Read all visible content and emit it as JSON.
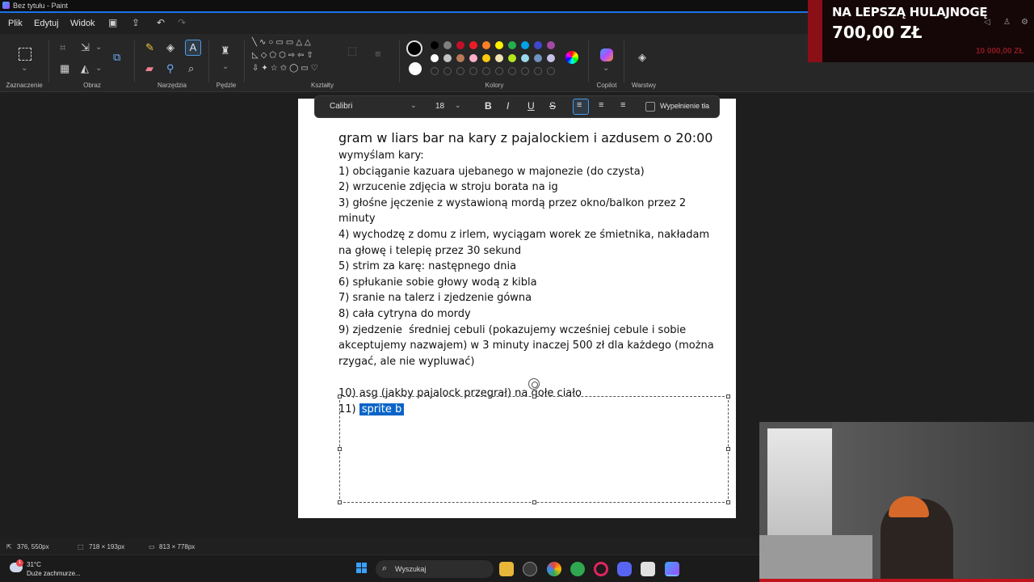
{
  "window": {
    "title": "Bez tytułu - Paint"
  },
  "menu": {
    "file": "Plik",
    "edit": "Edytuj",
    "view": "Widok"
  },
  "ribbon": {
    "groups": {
      "selection": "Zaznaczenie",
      "image": "Obraz",
      "tools": "Narzędzia",
      "brushes": "Pędzle",
      "shapes": "Kształty",
      "colors": "Kolory",
      "copilot": "Copilot",
      "layers": "Warstwy"
    },
    "primary_color": "#000000",
    "secondary_color": "#ffffff",
    "palette_row1": [
      "#000000",
      "#7f7f7f",
      "#c3102a",
      "#ed1c24",
      "#ff7f27",
      "#fff200",
      "#22b14c",
      "#00a2e8",
      "#3f48cc",
      "#a349a4"
    ],
    "palette_row2": [
      "#ffffff",
      "#c3c3c3",
      "#b97a57",
      "#ffaec9",
      "#ffc90e",
      "#efe4b0",
      "#b5e61d",
      "#99d9ea",
      "#7092be",
      "#c8bfe7"
    ]
  },
  "text_toolbar": {
    "font": "Calibri",
    "size": "18",
    "bold": "B",
    "italic": "I",
    "underline": "U",
    "strike": "S",
    "fill_background": "Wypełnienie tła"
  },
  "document": {
    "heading": "gram w liars bar na kary z pajalockiem i azdusem o 20:00",
    "lines": [
      "wymyślam kary:",
      "1) obciąganie kazuara ujebanego w majonezie (do czysta)",
      "2) wrzucenie zdjęcia w stroju borata na ig",
      "3) głośne jęczenie z wystawioną mordą przez okno/balkon przez 2",
      "minuty",
      "4) wychodzę z domu z irlem, wyciągam worek ze śmietnika, nakładam",
      "na głowę i telepię przez 30 sekund",
      "5) strim za karę: następnego dnia",
      "6) spłukanie sobie głowy wodą z kibla",
      "7) sranie na talerz i zjedzenie gówna",
      "8) cała cytryna do mordy",
      "9) zjedzenie  średniej cebuli (pokazujemy wcześniej cebule i sobie",
      "akceptujemy nazwajem) w 3 minuty inaczej 500 zł dla każdego (można",
      "rzygać, ale nie wypluwać)",
      "",
      "10) asg (jakby pajalock przegrał) na gołe ciało"
    ],
    "last_prefix": "11) ",
    "last_selected": "sprite b"
  },
  "status": {
    "cursor": "376, 550px",
    "selection": "718 × 193px",
    "canvas": "813 × 778px"
  },
  "taskbar": {
    "temp": "31°C",
    "weather": "Duże zachmurze...",
    "search_placeholder": "Wyszukaj"
  },
  "overlay": {
    "line1": "NA LEPSZĄ HULAJNOGĘ",
    "line2": "700,00 ZŁ",
    "line3": "10 000,00 ZŁ"
  }
}
